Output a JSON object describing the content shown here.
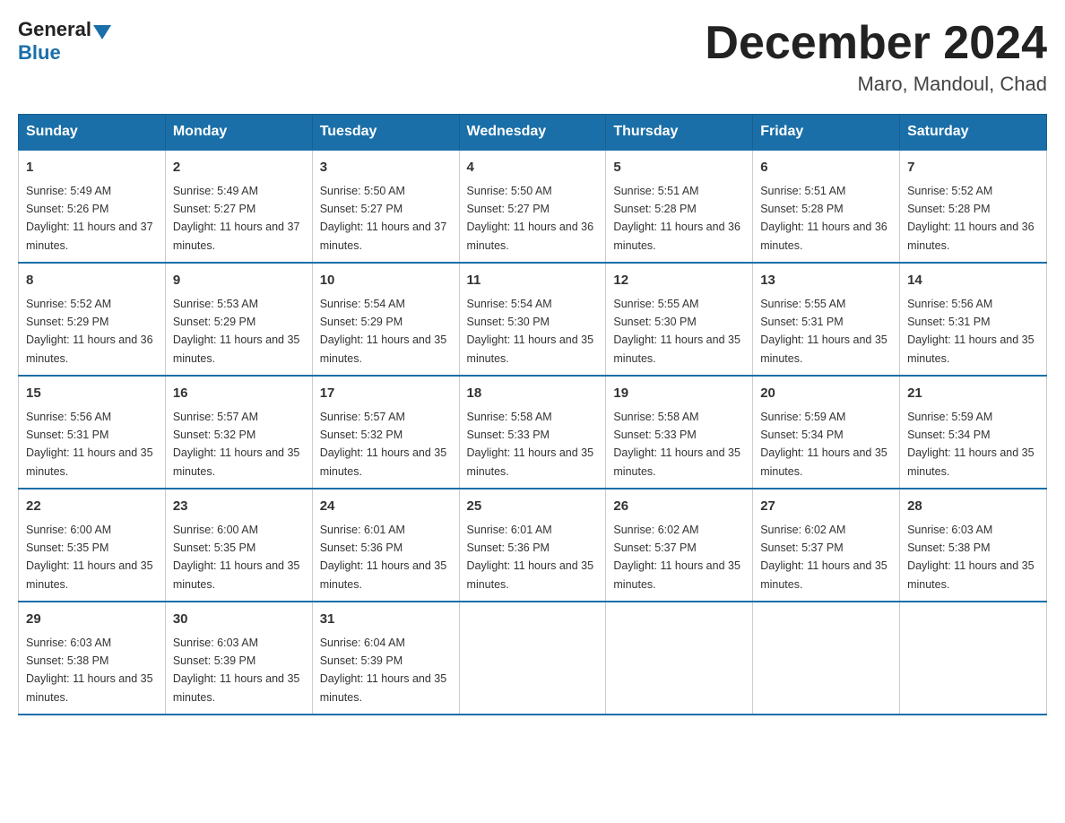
{
  "header": {
    "logo_general": "General",
    "logo_blue": "Blue",
    "month_title": "December 2024",
    "location": "Maro, Mandoul, Chad"
  },
  "weekdays": [
    "Sunday",
    "Monday",
    "Tuesday",
    "Wednesday",
    "Thursday",
    "Friday",
    "Saturday"
  ],
  "weeks": [
    [
      {
        "day": "1",
        "sunrise": "5:49 AM",
        "sunset": "5:26 PM",
        "daylight": "11 hours and 37 minutes."
      },
      {
        "day": "2",
        "sunrise": "5:49 AM",
        "sunset": "5:27 PM",
        "daylight": "11 hours and 37 minutes."
      },
      {
        "day": "3",
        "sunrise": "5:50 AM",
        "sunset": "5:27 PM",
        "daylight": "11 hours and 37 minutes."
      },
      {
        "day": "4",
        "sunrise": "5:50 AM",
        "sunset": "5:27 PM",
        "daylight": "11 hours and 36 minutes."
      },
      {
        "day": "5",
        "sunrise": "5:51 AM",
        "sunset": "5:28 PM",
        "daylight": "11 hours and 36 minutes."
      },
      {
        "day": "6",
        "sunrise": "5:51 AM",
        "sunset": "5:28 PM",
        "daylight": "11 hours and 36 minutes."
      },
      {
        "day": "7",
        "sunrise": "5:52 AM",
        "sunset": "5:28 PM",
        "daylight": "11 hours and 36 minutes."
      }
    ],
    [
      {
        "day": "8",
        "sunrise": "5:52 AM",
        "sunset": "5:29 PM",
        "daylight": "11 hours and 36 minutes."
      },
      {
        "day": "9",
        "sunrise": "5:53 AM",
        "sunset": "5:29 PM",
        "daylight": "11 hours and 35 minutes."
      },
      {
        "day": "10",
        "sunrise": "5:54 AM",
        "sunset": "5:29 PM",
        "daylight": "11 hours and 35 minutes."
      },
      {
        "day": "11",
        "sunrise": "5:54 AM",
        "sunset": "5:30 PM",
        "daylight": "11 hours and 35 minutes."
      },
      {
        "day": "12",
        "sunrise": "5:55 AM",
        "sunset": "5:30 PM",
        "daylight": "11 hours and 35 minutes."
      },
      {
        "day": "13",
        "sunrise": "5:55 AM",
        "sunset": "5:31 PM",
        "daylight": "11 hours and 35 minutes."
      },
      {
        "day": "14",
        "sunrise": "5:56 AM",
        "sunset": "5:31 PM",
        "daylight": "11 hours and 35 minutes."
      }
    ],
    [
      {
        "day": "15",
        "sunrise": "5:56 AM",
        "sunset": "5:31 PM",
        "daylight": "11 hours and 35 minutes."
      },
      {
        "day": "16",
        "sunrise": "5:57 AM",
        "sunset": "5:32 PM",
        "daylight": "11 hours and 35 minutes."
      },
      {
        "day": "17",
        "sunrise": "5:57 AM",
        "sunset": "5:32 PM",
        "daylight": "11 hours and 35 minutes."
      },
      {
        "day": "18",
        "sunrise": "5:58 AM",
        "sunset": "5:33 PM",
        "daylight": "11 hours and 35 minutes."
      },
      {
        "day": "19",
        "sunrise": "5:58 AM",
        "sunset": "5:33 PM",
        "daylight": "11 hours and 35 minutes."
      },
      {
        "day": "20",
        "sunrise": "5:59 AM",
        "sunset": "5:34 PM",
        "daylight": "11 hours and 35 minutes."
      },
      {
        "day": "21",
        "sunrise": "5:59 AM",
        "sunset": "5:34 PM",
        "daylight": "11 hours and 35 minutes."
      }
    ],
    [
      {
        "day": "22",
        "sunrise": "6:00 AM",
        "sunset": "5:35 PM",
        "daylight": "11 hours and 35 minutes."
      },
      {
        "day": "23",
        "sunrise": "6:00 AM",
        "sunset": "5:35 PM",
        "daylight": "11 hours and 35 minutes."
      },
      {
        "day": "24",
        "sunrise": "6:01 AM",
        "sunset": "5:36 PM",
        "daylight": "11 hours and 35 minutes."
      },
      {
        "day": "25",
        "sunrise": "6:01 AM",
        "sunset": "5:36 PM",
        "daylight": "11 hours and 35 minutes."
      },
      {
        "day": "26",
        "sunrise": "6:02 AM",
        "sunset": "5:37 PM",
        "daylight": "11 hours and 35 minutes."
      },
      {
        "day": "27",
        "sunrise": "6:02 AM",
        "sunset": "5:37 PM",
        "daylight": "11 hours and 35 minutes."
      },
      {
        "day": "28",
        "sunrise": "6:03 AM",
        "sunset": "5:38 PM",
        "daylight": "11 hours and 35 minutes."
      }
    ],
    [
      {
        "day": "29",
        "sunrise": "6:03 AM",
        "sunset": "5:38 PM",
        "daylight": "11 hours and 35 minutes."
      },
      {
        "day": "30",
        "sunrise": "6:03 AM",
        "sunset": "5:39 PM",
        "daylight": "11 hours and 35 minutes."
      },
      {
        "day": "31",
        "sunrise": "6:04 AM",
        "sunset": "5:39 PM",
        "daylight": "11 hours and 35 minutes."
      },
      null,
      null,
      null,
      null
    ]
  ],
  "labels": {
    "sunrise_prefix": "Sunrise: ",
    "sunset_prefix": "Sunset: ",
    "daylight_prefix": "Daylight: "
  }
}
